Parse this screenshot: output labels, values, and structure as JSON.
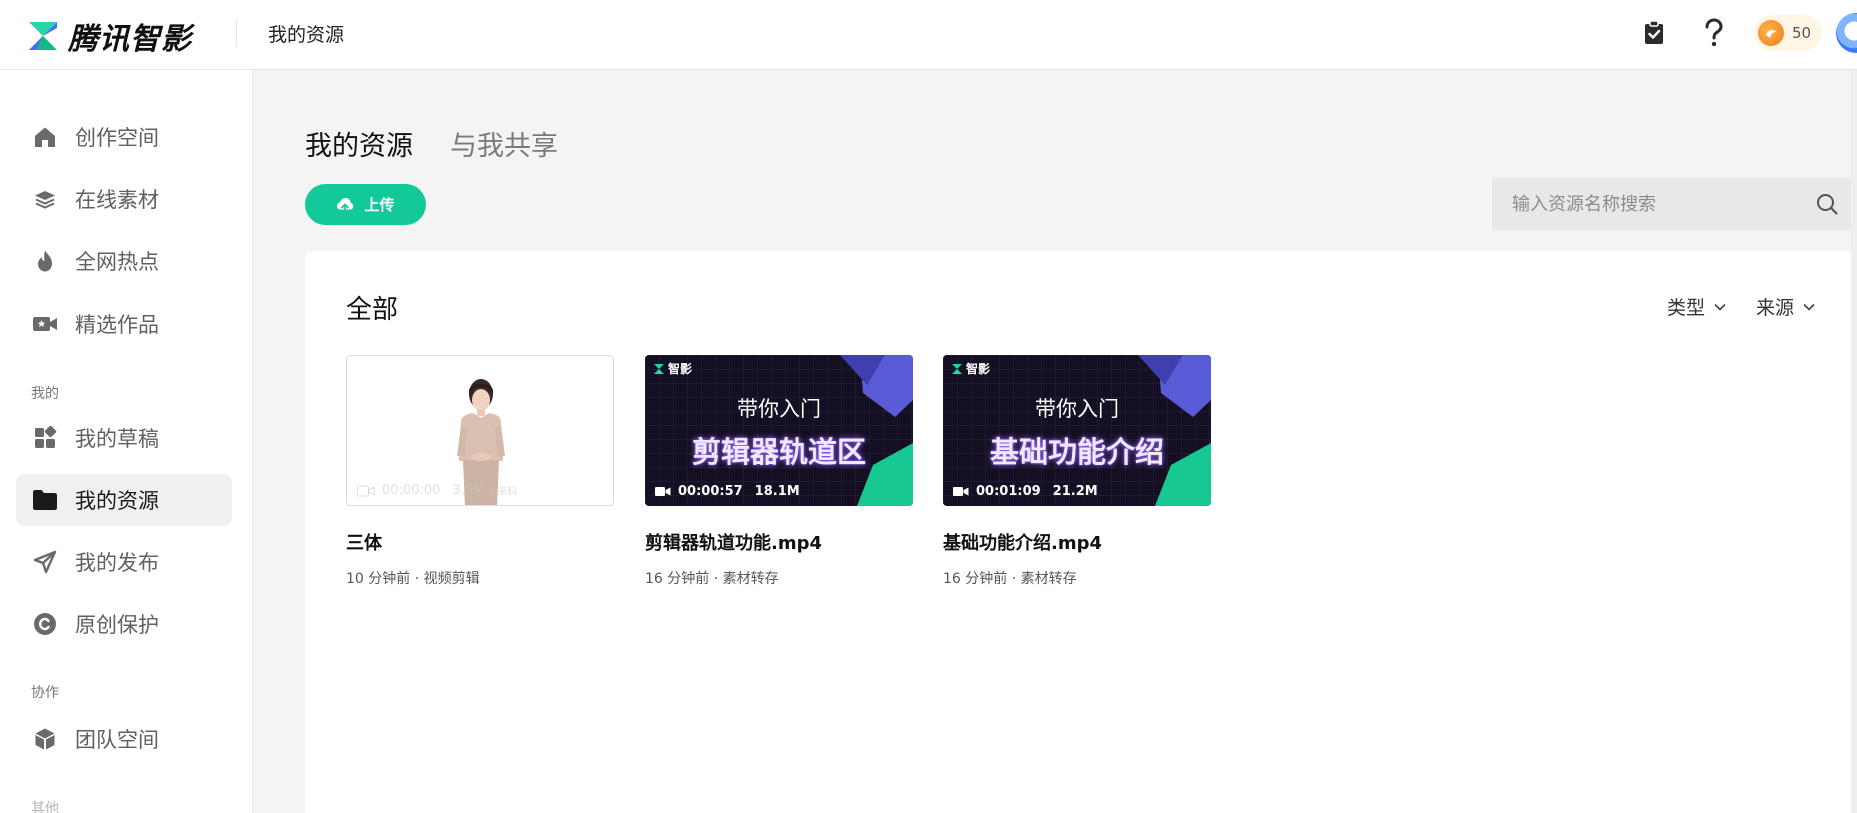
{
  "header": {
    "brand": "腾讯智影",
    "title": "我的资源",
    "coins": "50",
    "icons": [
      "clipboard-check-icon",
      "help-icon",
      "coin-icon",
      "avatar"
    ]
  },
  "sidebar": {
    "items": [
      {
        "label": "创作空间",
        "icon": "home-icon"
      },
      {
        "label": "在线素材",
        "icon": "layers-icon"
      },
      {
        "label": "全网热点",
        "icon": "fire-icon"
      },
      {
        "label": "精选作品",
        "icon": "video-star-icon"
      }
    ],
    "section_mine": "我的",
    "mine_items": [
      {
        "label": "我的草稿",
        "icon": "apps-icon"
      },
      {
        "label": "我的资源",
        "icon": "folder-icon",
        "active": true
      },
      {
        "label": "我的发布",
        "icon": "send-icon"
      },
      {
        "label": "原创保护",
        "icon": "copyright-icon"
      }
    ],
    "section_collab": "协作",
    "collab_items": [
      {
        "label": "团队空间",
        "icon": "cube-icon"
      }
    ],
    "section_other": "其他"
  },
  "main": {
    "tabs": [
      {
        "label": "我的资源",
        "active": true
      },
      {
        "label": "与我共享",
        "active": false
      }
    ],
    "upload_label": "上传",
    "search_placeholder": "输入资源名称搜索",
    "section_title": "全部",
    "filters": {
      "type": "类型",
      "source": "来源"
    },
    "colors": {
      "accent": "#13c99a"
    }
  },
  "cards": [
    {
      "title": "三体",
      "meta": "10 分钟前 · 视频剪辑",
      "thumb": "presenter",
      "duration": "00:00:00",
      "size": "3.5M",
      "watermark": "未来科"
    },
    {
      "title": "剪辑器轨道功能.mp4",
      "meta": "16 分钟前 · 素材转存",
      "thumb": "tutorial",
      "logo": "智影",
      "line1": "带你入门",
      "line2": "剪辑器轨道区",
      "duration": "00:00:57",
      "size": "18.1M"
    },
    {
      "title": "基础功能介绍.mp4",
      "meta": "16 分钟前 · 素材转存",
      "thumb": "tutorial",
      "logo": "智影",
      "line1": "带你入门",
      "line2": "基础功能介绍",
      "duration": "00:01:09",
      "size": "21.2M"
    }
  ]
}
